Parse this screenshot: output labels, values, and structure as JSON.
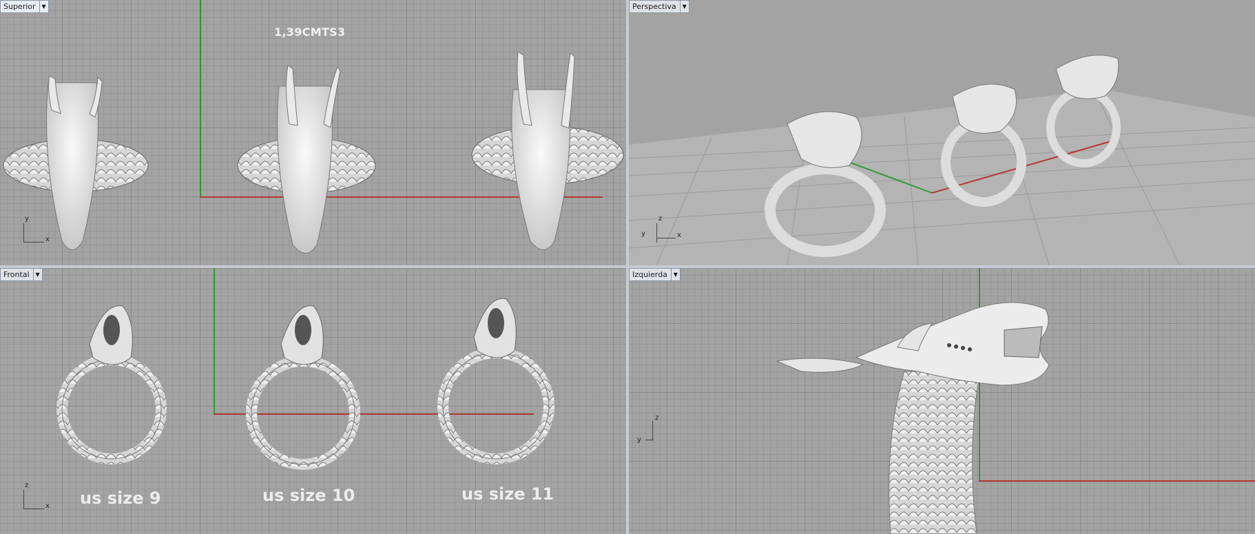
{
  "viewports": {
    "top": {
      "label": "Superior",
      "dimension_text": "1,39CMTS3",
      "triad": {
        "vertical": "y",
        "horizontal": "x"
      }
    },
    "perspective": {
      "label": "Perspectiva",
      "triad": {
        "vertical": "z",
        "left": "y",
        "horizontal": "x"
      }
    },
    "front": {
      "label": "Frontal",
      "triad": {
        "vertical": "z",
        "horizontal": "x"
      },
      "sizes": [
        "us size 9",
        "us size 10",
        "us size 11"
      ]
    },
    "left": {
      "label": "Izquierda",
      "triad": {
        "vertical": "z",
        "horizontal": "y"
      }
    }
  },
  "icons": {
    "dropdown": "chevron-down-icon",
    "model": "dragon-ring-model"
  },
  "colors": {
    "viewport_bg": "#a3a3a3",
    "x_axis": "#b5362f",
    "y_axis": "#2e9a2e",
    "divider": "#c7ccd4",
    "model": "#e8e8e8"
  }
}
